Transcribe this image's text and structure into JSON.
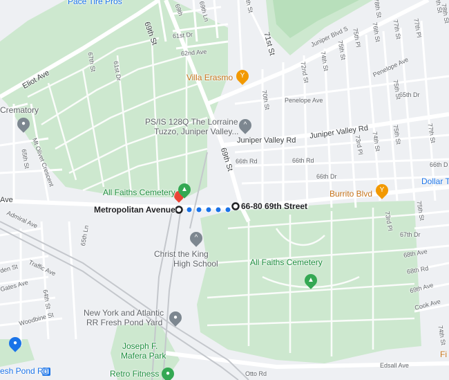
{
  "map": {
    "route": {
      "start_label": "Metropolitan Avenue",
      "end_label": "66-80 69th Street"
    },
    "places": {
      "pace_tire": "Pace Tire Pros",
      "crematory": "Crematory",
      "villa_erasmo": "Villa Erasmo",
      "ps128_line1": "PS/IS 128Q The Lorraine",
      "ps128_line2": "Tuzzo, Juniper Valley...",
      "all_faiths_top": "All Faiths Cemetery",
      "all_faiths_main": "All Faiths Cemetery",
      "burrito": "Burrito Blvd",
      "dollar_tree": "Dollar T",
      "christ_king_line1": "Christ the King",
      "christ_king_line2": "High School",
      "ny_atlantic_line1": "New York and Atlantic",
      "ny_atlantic_line2": "RR Fresh Pond Yard",
      "mafera_line1": "Joseph F.",
      "mafera_line2": "Mafera Park",
      "retro_fitness": "Retro Fitness",
      "fresh_pond_rd": "esh Pond Rd",
      "edge_f": "Fi"
    },
    "streets": {
      "eliot_ave": "Eliot Ave",
      "s69th_top": "69th St",
      "s69th_mid": "69th St",
      "s69th_tiny": "69th",
      "s61st_dr": "61st Dr",
      "s62nd_ave": "62nd Ave",
      "s67th_st": "67th St",
      "s65th_st": "65th St",
      "s65th_st_left": "65th St",
      "s65th_ln": "65th Ln",
      "s71st_st": "71st St",
      "s72nd_st": "72nd St",
      "s70th_st": "70th St",
      "s74th_st": "74th St",
      "s75th_st": "75th St",
      "s76th_st": "76th St",
      "s77th_st": "77th St",
      "s78th_st": "78th St",
      "s77th_pl": "77th Pl",
      "s75th_pl": "75th Pl",
      "s73rd_pl": "73rd Pl",
      "s73rd_pl_b": "73rd Pl",
      "s74th_st_b": "74th St",
      "s75th_st_b": "75th St",
      "s75th_st_c": "75th St",
      "s77th_st_b": "77th St",
      "s74th_st_c": "74th St",
      "juniper_blvd": "Juniper Blvd S",
      "penelope_ave": "Penelope Ave",
      "penelope_ave_b": "Penelope Ave",
      "s65th_dr": "65th Dr",
      "juniper_valley_rd": "Juniper Valley Rd",
      "juniper_valley_rd_b": "Juniper Valley Rd",
      "s66th_rd": "66th Rd",
      "s66th_rd_b": "66th Rd",
      "s66th_dr": "66th Dr",
      "s66th_dr_b": "66th D",
      "metro_ave": "Ave",
      "admiral_ave": "Admiral Ave",
      "traffic_ave": "Traffic Ave",
      "gates_ave": "Gates Ave",
      "woodbine_st": "Woodbine St",
      "linden_st": "den St",
      "s64th_st": "64th St",
      "s67th_dr": "67th Dr",
      "s68th_ave": "68th Ave",
      "s68th_rd": "68th Rd",
      "s69th_ave": "69th Ave",
      "cook_ave": "Cook Ave",
      "edsall_ave": "Edsall Ave",
      "otto_rd": "Otto Rd",
      "mt_olivet": "Mt Olivet Crescent",
      "s79th_st": "79th St",
      "s78th_st_top": "78th St",
      "s69th_ln": "69th Ln",
      "s68th_st": "68th St"
    }
  }
}
